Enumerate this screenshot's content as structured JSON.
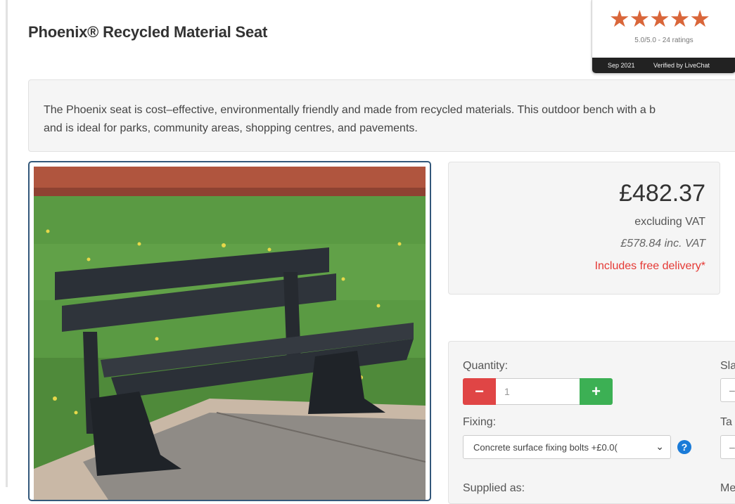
{
  "product": {
    "title": "Phoenix® Recycled Material Seat",
    "description": "The Phoenix seat is cost–effective, environmentally friendly and made from recycled materials. This outdoor bench with a b\nand is ideal for parks, community areas, shopping centres, and pavements."
  },
  "rating": {
    "stars": "★★★★★",
    "summary": "5.0/5.0 - 24 ratings",
    "date": "Sep 2021",
    "verified": "Verified by LiveChat",
    "star_color": "#d9663a"
  },
  "pricing": {
    "price": "£482.37",
    "vat_label": "excluding VAT",
    "inc_vat": "£578.84 inc. VAT",
    "delivery": "Includes free delivery*",
    "delivery_color": "#e53935"
  },
  "options": {
    "quantity_label": "Quantity:",
    "quantity_value": "1",
    "minus_label": "−",
    "plus_label": "+",
    "minus_color": "#e04545",
    "plus_color": "#3cb054",
    "fixing_label": "Fixing:",
    "fixing_value": "Concrete surface fixing bolts +£0.0(",
    "help_label": "?",
    "supplied_label": "Supplied as:",
    "right_labels": [
      "Sla",
      "Ta",
      "Me"
    ],
    "right_select_value": "–"
  },
  "image": {
    "alt_icon": "bench-photo"
  }
}
